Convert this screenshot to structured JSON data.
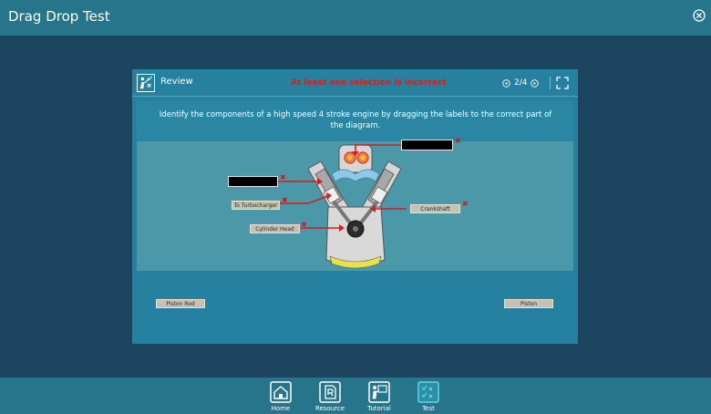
{
  "app": {
    "title": "Drag Drop Test"
  },
  "panel": {
    "review_label": "Review",
    "feedback": "At least one selection is incorrect",
    "pager": "2/4",
    "question": "Identify the components of a high speed 4 stroke engine by dragging the labels to the correct part of the diagram."
  },
  "diagram": {
    "placed_labels": {
      "turbo": "To Turbocharger",
      "cylinder_head": "Cylinder Head",
      "crankshaft": "Crankshaft"
    }
  },
  "label_bank": {
    "piston_rod": "Piston Rod",
    "piston": "Piston"
  },
  "bottom_nav": {
    "home": "Home",
    "resource": "Resource",
    "tutorial": "Tutorial",
    "test": "Test"
  },
  "colors": {
    "feedback": "#d42020",
    "marker": "#c71f1f",
    "active_nav": "#5cd6e8"
  }
}
